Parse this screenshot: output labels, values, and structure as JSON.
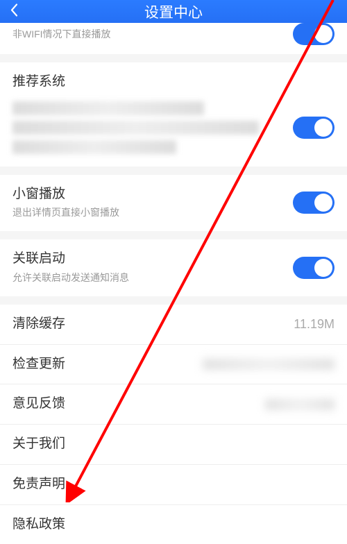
{
  "header": {
    "title": "设置中心"
  },
  "items": {
    "non_wifi_play": {
      "label": "非WIFI情况下直接播放"
    },
    "recommend_system": {
      "label": "推荐系统"
    },
    "mini_window": {
      "label": "小窗播放",
      "sublabel": "退出详情页直接小窗播放"
    },
    "assoc_launch": {
      "label": "关联启动",
      "sublabel": "允许关联启动发送通知消息"
    },
    "clear_cache": {
      "label": "清除缓存",
      "value": "11.19M"
    },
    "check_update": {
      "label": "检查更新"
    },
    "feedback": {
      "label": "意见反馈"
    },
    "about_us": {
      "label": "关于我们"
    },
    "disclaimer": {
      "label": "免责声明"
    },
    "privacy": {
      "label": "隐私政策"
    }
  }
}
